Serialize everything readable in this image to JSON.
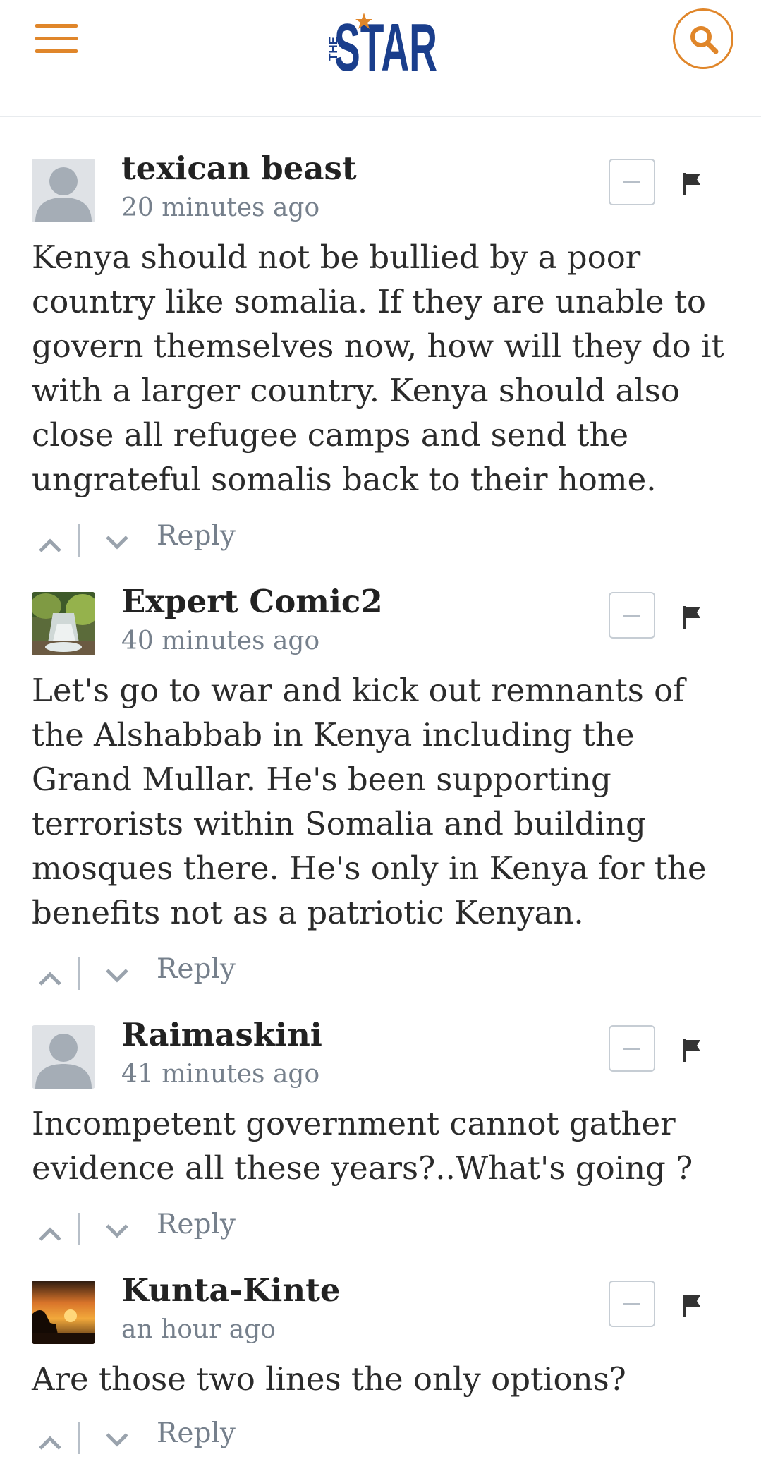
{
  "header": {
    "logo_small": "THE",
    "logo_main": "STAR",
    "brand_color": "#e0862a",
    "logo_color": "#1a3e8c"
  },
  "icons": {
    "menu": "hamburger-menu-icon",
    "search": "search-icon",
    "collapse": "minus-icon",
    "flag": "flag-icon",
    "upvote": "chevron-up-icon",
    "downvote": "chevron-down-icon"
  },
  "reply_label": "Reply",
  "comments": [
    {
      "author": "texican beast",
      "time": "20 minutes ago",
      "avatar": "default",
      "text": "Kenya should not be bullied by a poor country like somalia. If they are unable to govern themselves now, how will they do it with a larger country. Kenya should also close all refugee camps and send the ungrateful somalis back to their home."
    },
    {
      "author": "Expert Comic2",
      "time": "40 minutes ago",
      "avatar": "waterfall-photo",
      "text": "Let's go to war and kick out remnants of the Alshabbab in Kenya including the Grand Mullar. He's been supporting terrorists within Somalia and building mosques there. He's only in Kenya for the benefits not as a patriotic Kenyan."
    },
    {
      "author": "Raimaskini",
      "time": "41 minutes ago",
      "avatar": "default",
      "text": "Incompetent government cannot gather evidence all these years?..What's going ?"
    },
    {
      "author": "Kunta-Kinte",
      "time": "an hour ago",
      "avatar": "sunset-photo",
      "text": "Are those two lines the only options?"
    }
  ]
}
